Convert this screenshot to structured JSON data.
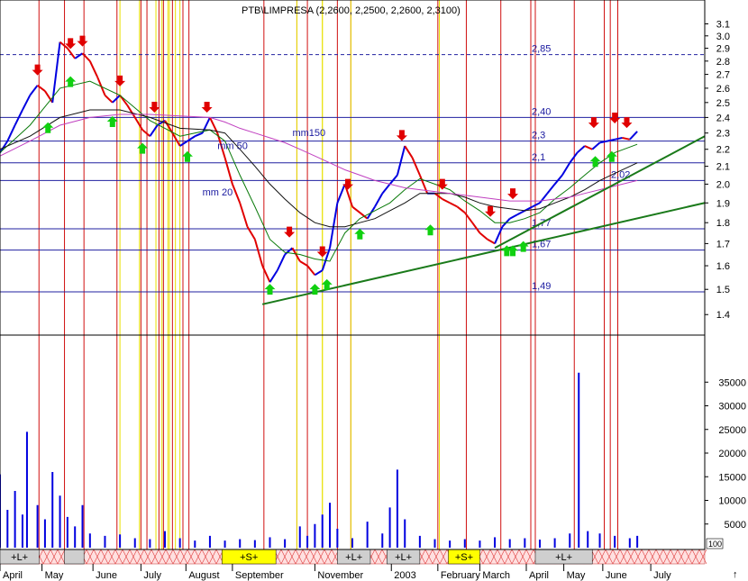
{
  "chart_data": {
    "type": "line",
    "title": "PTB\\LIMPRESA (2,2600, 2,2500, 2,2600, 2,3100)",
    "price_axis": {
      "ylim": [
        1.35,
        3.15
      ],
      "ticks": [
        "3.1",
        "3.0",
        "2.9",
        "2.8",
        "2.7",
        "2.6",
        "2.5",
        "2.4",
        "2.3",
        "2.2",
        "2.1",
        "2.0",
        "1.9",
        "1.8",
        "1.7",
        "1.6",
        "1.5",
        "1.4"
      ],
      "scale": "log"
    },
    "volume_axis": {
      "ylim": [
        0,
        40000
      ],
      "ticks": [
        "35000",
        "30000",
        "25000",
        "20000",
        "15000",
        "10000",
        "5000"
      ],
      "box_label": "100"
    },
    "x_axis": {
      "months": [
        "April",
        "May",
        "June",
        "July",
        "August",
        "September",
        "November",
        "2003",
        "February",
        "March",
        "April",
        "May",
        "June",
        "July"
      ],
      "x_range_days": [
        0,
        470
      ]
    },
    "series": [
      {
        "name": "mm 20",
        "color": "#0a7a0a"
      },
      {
        "name": "mm 50",
        "color": "#111111"
      },
      {
        "name": "mm150",
        "color": "#c040c0"
      }
    ],
    "price_path": [
      [
        0,
        2.18
      ],
      [
        5,
        2.25
      ],
      [
        10,
        2.35
      ],
      [
        15,
        2.45
      ],
      [
        20,
        2.55
      ],
      [
        25,
        2.62
      ],
      [
        30,
        2.58
      ],
      [
        35,
        2.5
      ],
      [
        40,
        2.95
      ],
      [
        45,
        2.9
      ],
      [
        50,
        2.82
      ],
      [
        55,
        2.86
      ],
      [
        60,
        2.8
      ],
      [
        65,
        2.68
      ],
      [
        70,
        2.55
      ],
      [
        75,
        2.5
      ],
      [
        80,
        2.55
      ],
      [
        85,
        2.48
      ],
      [
        90,
        2.4
      ],
      [
        95,
        2.32
      ],
      [
        100,
        2.28
      ],
      [
        105,
        2.35
      ],
      [
        110,
        2.38
      ],
      [
        115,
        2.3
      ],
      [
        120,
        2.22
      ],
      [
        125,
        2.25
      ],
      [
        130,
        2.28
      ],
      [
        135,
        2.3
      ],
      [
        140,
        2.4
      ],
      [
        145,
        2.3
      ],
      [
        150,
        2.15
      ],
      [
        155,
        2.0
      ],
      [
        160,
        1.9
      ],
      [
        165,
        1.78
      ],
      [
        170,
        1.72
      ],
      [
        175,
        1.6
      ],
      [
        180,
        1.53
      ],
      [
        185,
        1.58
      ],
      [
        190,
        1.65
      ],
      [
        195,
        1.68
      ],
      [
        200,
        1.62
      ],
      [
        205,
        1.6
      ],
      [
        210,
        1.56
      ],
      [
        215,
        1.58
      ],
      [
        220,
        1.68
      ],
      [
        225,
        1.9
      ],
      [
        230,
        2.0
      ],
      [
        235,
        1.88
      ],
      [
        240,
        1.85
      ],
      [
        245,
        1.82
      ],
      [
        250,
        1.88
      ],
      [
        255,
        1.95
      ],
      [
        260,
        2.0
      ],
      [
        265,
        2.05
      ],
      [
        270,
        2.22
      ],
      [
        275,
        2.15
      ],
      [
        280,
        2.05
      ],
      [
        285,
        1.95
      ],
      [
        290,
        1.95
      ],
      [
        295,
        1.92
      ],
      [
        300,
        1.9
      ],
      [
        305,
        1.88
      ],
      [
        310,
        1.85
      ],
      [
        315,
        1.8
      ],
      [
        320,
        1.75
      ],
      [
        325,
        1.72
      ],
      [
        330,
        1.7
      ],
      [
        335,
        1.78
      ],
      [
        340,
        1.82
      ],
      [
        345,
        1.84
      ],
      [
        350,
        1.86
      ],
      [
        355,
        1.88
      ],
      [
        360,
        1.9
      ],
      [
        365,
        1.95
      ],
      [
        370,
        2.0
      ],
      [
        375,
        2.05
      ],
      [
        380,
        2.12
      ],
      [
        385,
        2.18
      ],
      [
        390,
        2.22
      ],
      [
        395,
        2.2
      ],
      [
        400,
        2.24
      ],
      [
        405,
        2.25
      ],
      [
        410,
        2.26
      ],
      [
        415,
        2.27
      ],
      [
        420,
        2.26
      ],
      [
        425,
        2.31
      ]
    ],
    "moving_averages": {
      "mm 20": [
        [
          0,
          2.18
        ],
        [
          20,
          2.35
        ],
        [
          40,
          2.6
        ],
        [
          60,
          2.65
        ],
        [
          80,
          2.55
        ],
        [
          100,
          2.38
        ],
        [
          120,
          2.28
        ],
        [
          140,
          2.32
        ],
        [
          150,
          2.25
        ],
        [
          160,
          2.05
        ],
        [
          170,
          1.88
        ],
        [
          180,
          1.72
        ],
        [
          190,
          1.66
        ],
        [
          200,
          1.65
        ],
        [
          210,
          1.63
        ],
        [
          220,
          1.62
        ],
        [
          230,
          1.75
        ],
        [
          240,
          1.82
        ],
        [
          250,
          1.86
        ],
        [
          260,
          1.9
        ],
        [
          270,
          1.97
        ],
        [
          280,
          2.03
        ],
        [
          290,
          2.0
        ],
        [
          300,
          1.97
        ],
        [
          310,
          1.91
        ],
        [
          320,
          1.86
        ],
        [
          330,
          1.8
        ],
        [
          340,
          1.8
        ],
        [
          350,
          1.82
        ],
        [
          360,
          1.85
        ],
        [
          370,
          1.92
        ],
        [
          380,
          1.98
        ],
        [
          390,
          2.05
        ],
        [
          400,
          2.12
        ],
        [
          410,
          2.18
        ],
        [
          425,
          2.23
        ]
      ],
      "mm 50": [
        [
          0,
          2.2
        ],
        [
          20,
          2.28
        ],
        [
          40,
          2.4
        ],
        [
          60,
          2.45
        ],
        [
          80,
          2.45
        ],
        [
          100,
          2.4
        ],
        [
          120,
          2.33
        ],
        [
          140,
          2.32
        ],
        [
          150,
          2.3
        ],
        [
          160,
          2.2
        ],
        [
          170,
          2.1
        ],
        [
          180,
          2.0
        ],
        [
          190,
          1.92
        ],
        [
          200,
          1.85
        ],
        [
          210,
          1.8
        ],
        [
          220,
          1.78
        ],
        [
          230,
          1.78
        ],
        [
          240,
          1.8
        ],
        [
          250,
          1.82
        ],
        [
          260,
          1.86
        ],
        [
          270,
          1.9
        ],
        [
          280,
          1.95
        ],
        [
          290,
          1.95
        ],
        [
          300,
          1.95
        ],
        [
          310,
          1.93
        ],
        [
          320,
          1.9
        ],
        [
          330,
          1.88
        ],
        [
          340,
          1.87
        ],
        [
          350,
          1.86
        ],
        [
          360,
          1.87
        ],
        [
          370,
          1.9
        ],
        [
          380,
          1.93
        ],
        [
          390,
          1.97
        ],
        [
          400,
          2.02
        ],
        [
          410,
          2.06
        ],
        [
          425,
          2.12
        ]
      ],
      "mm150": [
        [
          0,
          2.16
        ],
        [
          20,
          2.25
        ],
        [
          40,
          2.35
        ],
        [
          60,
          2.4
        ],
        [
          80,
          2.42
        ],
        [
          100,
          2.42
        ],
        [
          120,
          2.41
        ],
        [
          140,
          2.4
        ],
        [
          150,
          2.37
        ],
        [
          160,
          2.33
        ],
        [
          170,
          2.3
        ],
        [
          180,
          2.27
        ],
        [
          190,
          2.24
        ],
        [
          200,
          2.2
        ],
        [
          210,
          2.16
        ],
        [
          220,
          2.12
        ],
        [
          230,
          2.08
        ],
        [
          240,
          2.05
        ],
        [
          250,
          2.02
        ],
        [
          260,
          2.0
        ],
        [
          270,
          1.98
        ],
        [
          280,
          1.97
        ],
        [
          290,
          1.96
        ],
        [
          300,
          1.95
        ],
        [
          310,
          1.94
        ],
        [
          320,
          1.93
        ],
        [
          330,
          1.92
        ],
        [
          340,
          1.91
        ],
        [
          350,
          1.91
        ],
        [
          360,
          1.91
        ],
        [
          370,
          1.92
        ],
        [
          380,
          1.93
        ],
        [
          390,
          1.95
        ],
        [
          400,
          1.97
        ],
        [
          410,
          1.99
        ],
        [
          425,
          2.02
        ]
      ]
    },
    "horizontal_levels": [
      {
        "label": "2,85",
        "value": 2.85,
        "style": "dashed"
      },
      {
        "label": "2,40",
        "value": 2.4
      },
      {
        "label": "2,3",
        "value": 2.25
      },
      {
        "label": "2,1",
        "value": 2.12
      },
      {
        "label": "2,02",
        "value": 2.02
      },
      {
        "label": "1,77",
        "value": 1.77
      },
      {
        "label": "1,67",
        "value": 1.67
      },
      {
        "label": "1,49",
        "value": 1.49
      }
    ],
    "trend_lines": [
      {
        "from": [
          175,
          1.44
        ],
        "to": [
          470,
          1.9
        ],
        "color": "#1a7a1a"
      },
      {
        "from": [
          330,
          1.68
        ],
        "to": [
          470,
          2.28
        ],
        "color": "#1a7a1a"
      }
    ],
    "sell_arrows": [
      [
        25,
        2.68
      ],
      [
        47,
        2.88
      ],
      [
        55,
        2.9
      ],
      [
        80,
        2.6
      ],
      [
        103,
        2.42
      ],
      [
        138,
        2.42
      ],
      [
        193,
        1.72
      ],
      [
        215,
        1.63
      ],
      [
        232,
        1.96
      ],
      [
        268,
        2.24
      ],
      [
        295,
        1.96
      ],
      [
        327,
        1.82
      ],
      [
        342,
        1.91
      ],
      [
        396,
        2.32
      ],
      [
        410,
        2.35
      ],
      [
        418,
        2.32
      ]
    ],
    "buy_arrows": [
      [
        32,
        2.38
      ],
      [
        47,
        2.7
      ],
      [
        75,
        2.42
      ],
      [
        95,
        2.25
      ],
      [
        125,
        2.2
      ],
      [
        180,
        1.53
      ],
      [
        210,
        1.53
      ],
      [
        218,
        1.55
      ],
      [
        240,
        1.78
      ],
      [
        287,
        1.8
      ],
      [
        338,
        1.7
      ],
      [
        342,
        1.7
      ],
      [
        349,
        1.72
      ],
      [
        397,
        2.17
      ],
      [
        408,
        2.2
      ]
    ],
    "signal_days": [
      26,
      43,
      56,
      78,
      94,
      98,
      106,
      109,
      115,
      122,
      126,
      176,
      198,
      205,
      225,
      234,
      292,
      311,
      334,
      354,
      357,
      383,
      403,
      407,
      412
    ],
    "signal_days_yellow": [
      80,
      93,
      104,
      108,
      112,
      113,
      117,
      120,
      198,
      215,
      215,
      234,
      293
    ],
    "volume": [
      [
        0,
        15500
      ],
      [
        5,
        8000
      ],
      [
        10,
        12000
      ],
      [
        15,
        7000
      ],
      [
        18,
        24500
      ],
      [
        25,
        9000
      ],
      [
        30,
        6000
      ],
      [
        35,
        16000
      ],
      [
        40,
        11000
      ],
      [
        45,
        6500
      ],
      [
        50,
        4500
      ],
      [
        55,
        9000
      ],
      [
        60,
        3000
      ],
      [
        70,
        2500
      ],
      [
        80,
        2800
      ],
      [
        90,
        2000
      ],
      [
        100,
        1800
      ],
      [
        110,
        3500
      ],
      [
        120,
        2000
      ],
      [
        130,
        1500
      ],
      [
        140,
        2500
      ],
      [
        150,
        1500
      ],
      [
        160,
        1800
      ],
      [
        170,
        1600
      ],
      [
        180,
        2200
      ],
      [
        190,
        1800
      ],
      [
        200,
        4500
      ],
      [
        205,
        2500
      ],
      [
        210,
        5000
      ],
      [
        215,
        7000
      ],
      [
        220,
        9500
      ],
      [
        225,
        4000
      ],
      [
        235,
        2000
      ],
      [
        245,
        5500
      ],
      [
        255,
        3000
      ],
      [
        260,
        8500
      ],
      [
        265,
        16500
      ],
      [
        270,
        6000
      ],
      [
        280,
        2500
      ],
      [
        290,
        1800
      ],
      [
        300,
        1500
      ],
      [
        310,
        1800
      ],
      [
        320,
        1500
      ],
      [
        330,
        2200
      ],
      [
        340,
        1800
      ],
      [
        350,
        2000
      ],
      [
        360,
        1700
      ],
      [
        370,
        2000
      ],
      [
        380,
        3000
      ],
      [
        386,
        37000
      ],
      [
        392,
        3500
      ],
      [
        400,
        3000
      ],
      [
        410,
        2500
      ],
      [
        420,
        2000
      ],
      [
        425,
        2500
      ]
    ],
    "signal_strip": [
      {
        "label": "+L+",
        "from": 0,
        "to": 26,
        "color": "#cfcfcf"
      },
      {
        "label": "",
        "from": 43,
        "to": 56,
        "color": "#cfcfcf"
      },
      {
        "label": "+S+",
        "from": 148,
        "to": 184,
        "color": "#ffff00"
      },
      {
        "label": "+L+",
        "from": 225,
        "to": 247,
        "color": "#cfcfcf"
      },
      {
        "label": "+L+",
        "from": 258,
        "to": 280,
        "color": "#cfcfcf"
      },
      {
        "label": "+S+",
        "from": 299,
        "to": 320,
        "color": "#ffff00"
      },
      {
        "label": "+L+",
        "from": 357,
        "to": 395,
        "color": "#cfcfcf"
      }
    ]
  }
}
